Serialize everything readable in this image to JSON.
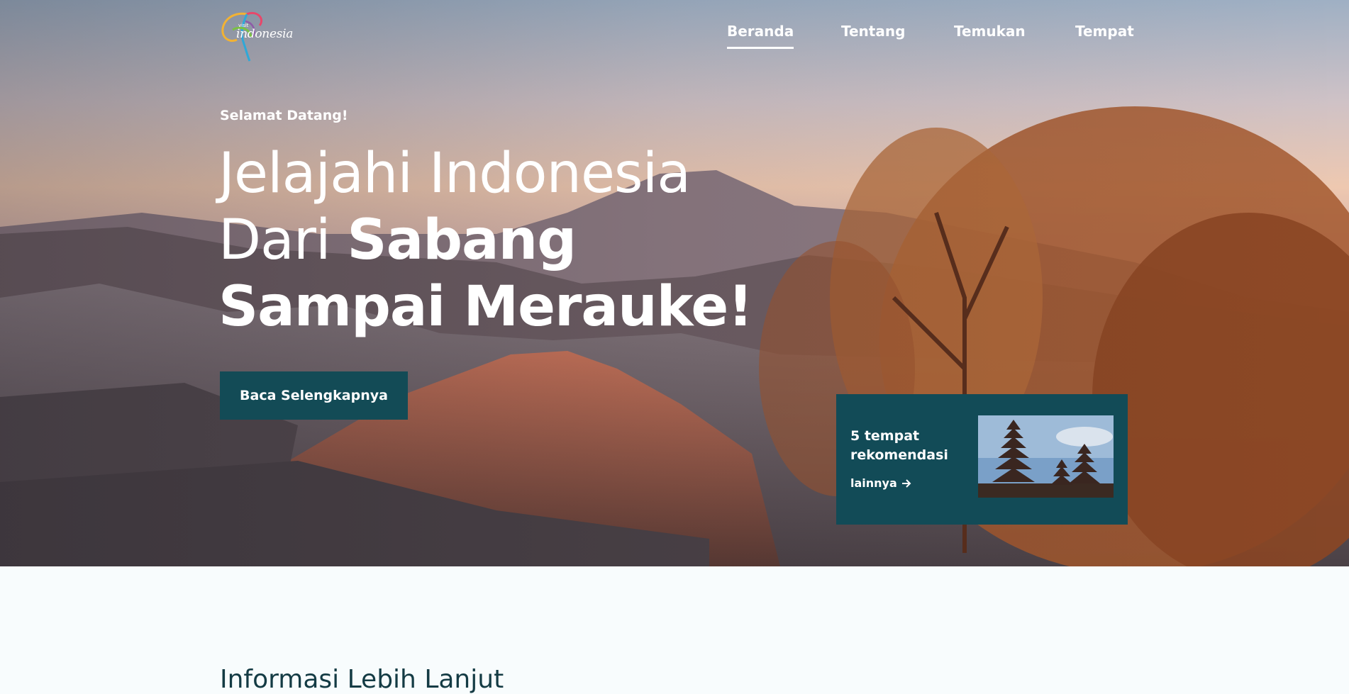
{
  "brand": {
    "visit": "visit",
    "name": "indonesia"
  },
  "nav": {
    "items": [
      {
        "label": "Beranda",
        "active": true
      },
      {
        "label": "Tentang",
        "active": false
      },
      {
        "label": "Temukan",
        "active": false
      },
      {
        "label": "Tempat",
        "active": false
      }
    ]
  },
  "hero": {
    "greeting": "Selamat Datang!",
    "headline": {
      "line1": "Jelajahi Indonesia",
      "line2_light": "Dari ",
      "line2_bold": "Sabang",
      "line3": "Sampai Merauke!"
    },
    "cta_label": "Baca Selengkapnya"
  },
  "card": {
    "title": "5 tempat rekomendasi",
    "link_label": "lainnya",
    "link_icon": "arrow-right-icon",
    "image": "pagoda-temple-photo"
  },
  "section": {
    "title": "Informasi Lebih Lanjut"
  },
  "colors": {
    "accent": "#134b56",
    "card": "#124b57",
    "page_bg": "#f8fcfd"
  }
}
